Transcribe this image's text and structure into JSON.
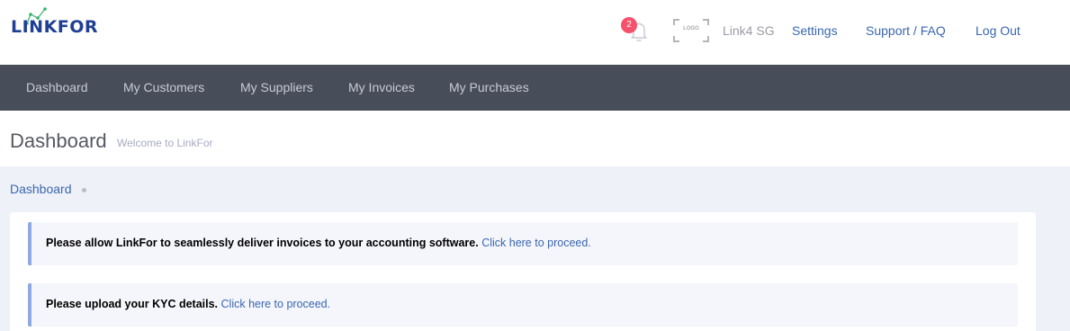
{
  "header": {
    "logo_text": "LINKFOR",
    "notification_count": "2",
    "company_logo_text": "LOGO",
    "company_name": "Link4 SG",
    "links": {
      "settings": "Settings",
      "support": "Support / FAQ",
      "logout": "Log Out"
    }
  },
  "nav": {
    "items": [
      "Dashboard",
      "My Customers",
      "My Suppliers",
      "My Invoices",
      "My Purchases"
    ]
  },
  "page": {
    "title": "Dashboard",
    "subtitle": "Welcome to LinkFor"
  },
  "breadcrumb": {
    "label": "Dashboard"
  },
  "alerts": [
    {
      "text": "Please allow LinkFor to seamlessly deliver invoices to your accounting software.",
      "link": "Click here to proceed."
    },
    {
      "text": "Please upload your KYC details.",
      "link": "Click here to proceed."
    }
  ],
  "colors": {
    "brand": "#1f3f95",
    "logo_accent": "#34b36a",
    "navbar": "#474d59",
    "link": "#3a66b0",
    "badge": "#f4516c",
    "alert_border": "#8fa8e0"
  },
  "icons": {
    "bell": "bell-icon",
    "company_logo": "company-logo-placeholder"
  }
}
